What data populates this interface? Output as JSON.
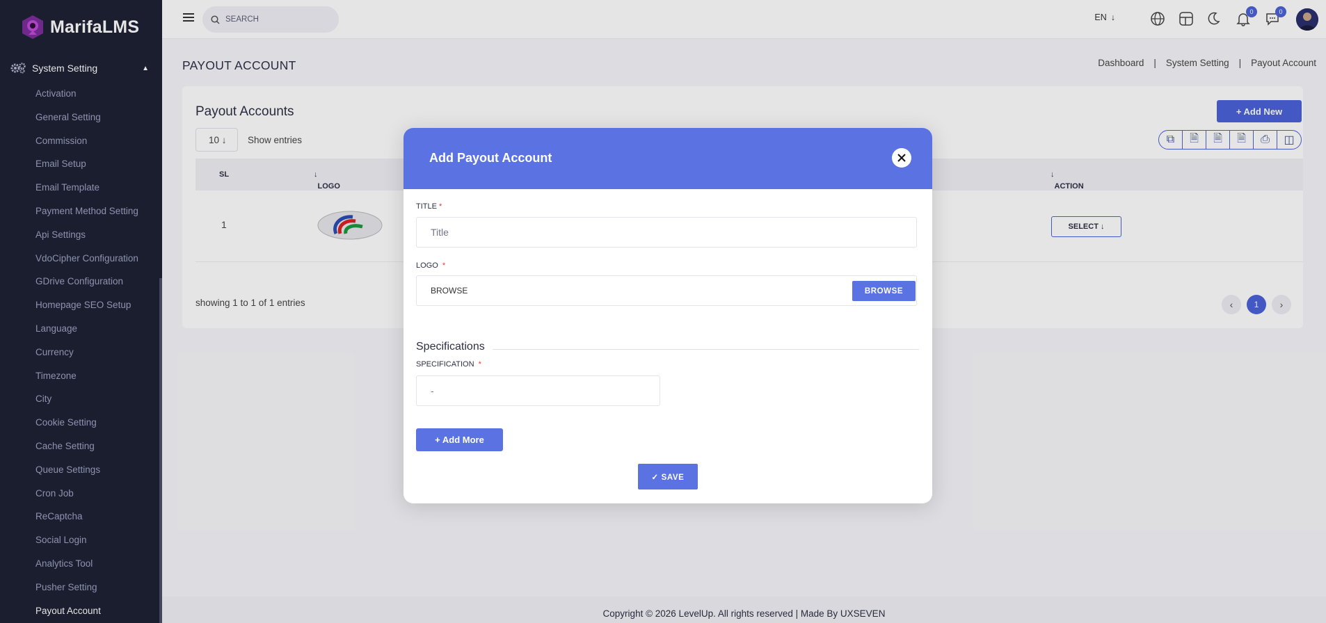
{
  "brand": {
    "name": "MarifaLMS"
  },
  "sidebar": {
    "section_label": "System Setting",
    "items": [
      {
        "label": "Activation"
      },
      {
        "label": "General Setting"
      },
      {
        "label": "Commission"
      },
      {
        "label": "Email Setup"
      },
      {
        "label": "Email Template"
      },
      {
        "label": "Payment Method Setting"
      },
      {
        "label": "Api Settings"
      },
      {
        "label": "VdoCipher Configuration"
      },
      {
        "label": "GDrive Configuration"
      },
      {
        "label": "Homepage SEO Setup"
      },
      {
        "label": "Language"
      },
      {
        "label": "Currency"
      },
      {
        "label": "Timezone"
      },
      {
        "label": "City"
      },
      {
        "label": "Cookie Setting"
      },
      {
        "label": "Cache Setting"
      },
      {
        "label": "Queue Settings"
      },
      {
        "label": "Cron Job"
      },
      {
        "label": "ReCaptcha"
      },
      {
        "label": "Social Login"
      },
      {
        "label": "Analytics Tool"
      },
      {
        "label": "Pusher Setting"
      },
      {
        "label": "Payout Account"
      }
    ]
  },
  "header": {
    "search_placeholder": "SEARCH",
    "language": "EN",
    "notification_count": "0",
    "message_count": "0"
  },
  "page": {
    "title": "PAYOUT ACCOUNT",
    "breadcrumbs": [
      "Dashboard",
      "System Setting",
      "Payout Account"
    ],
    "breadcrumb_sep": "|"
  },
  "table_card": {
    "title": "Payout Accounts",
    "add_new_label": "Add New",
    "page_size": "10",
    "show_entries_label": "Show entries",
    "columns": {
      "sl": "SL",
      "logo": "LOGO",
      "action": "ACTION"
    },
    "rows": [
      {
        "sl": "1",
        "action_label": "SELECT"
      }
    ],
    "showing_text": "showing 1 to 1 of 1 entries",
    "current_page": "1"
  },
  "modal": {
    "title": "Add Payout Account",
    "title_label": "TITLE",
    "title_placeholder": "Title",
    "logo_label": "LOGO",
    "logo_value": "BROWSE",
    "browse_label": "BROWSE",
    "specifications_heading": "Specifications",
    "specification_label": "SPECIFICATION",
    "specification_placeholder": "-",
    "add_more_label": "Add More",
    "save_label": "SAVE",
    "required_mark": "*"
  },
  "footer": {
    "text": "Copyright © 2026 LevelUp. All rights reserved | Made By UXSEVEN"
  },
  "colors": {
    "accent": "#5b72e3",
    "sidebar_bg": "#1f2235",
    "required": "#e2343f"
  }
}
